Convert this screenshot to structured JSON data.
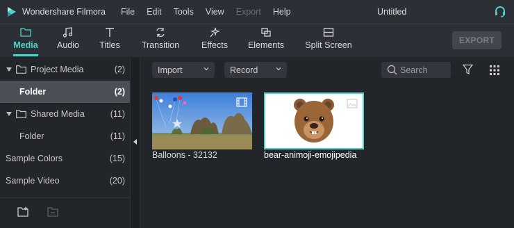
{
  "app": {
    "name": "Wondershare Filmora",
    "document_title": "Untitled"
  },
  "menu": [
    {
      "label": "File",
      "enabled": true
    },
    {
      "label": "Edit",
      "enabled": true
    },
    {
      "label": "Tools",
      "enabled": true
    },
    {
      "label": "View",
      "enabled": true
    },
    {
      "label": "Export",
      "enabled": false
    },
    {
      "label": "Help",
      "enabled": true
    }
  ],
  "toolbar": {
    "tabs": [
      {
        "label": "Media",
        "icon": "folder-icon",
        "active": true
      },
      {
        "label": "Audio",
        "icon": "music-note-icon",
        "active": false
      },
      {
        "label": "Titles",
        "icon": "text-icon",
        "active": false
      },
      {
        "label": "Transition",
        "icon": "transition-icon",
        "active": false
      },
      {
        "label": "Effects",
        "icon": "effects-icon",
        "active": false
      },
      {
        "label": "Elements",
        "icon": "elements-icon",
        "active": false
      },
      {
        "label": "Split Screen",
        "icon": "split-screen-icon",
        "active": false
      }
    ],
    "export_label": "EXPORT"
  },
  "sidebar": {
    "items": [
      {
        "label": "Project Media",
        "count": "(2)"
      },
      {
        "label": "Folder",
        "count": "(2)"
      },
      {
        "label": "Shared Media",
        "count": "(11)"
      },
      {
        "label": "Folder",
        "count": "(11)"
      },
      {
        "label": "Sample Colors",
        "count": "(15)"
      },
      {
        "label": "Sample Video",
        "count": "(20)"
      }
    ]
  },
  "media": {
    "import_label": "Import",
    "record_label": "Record",
    "search_placeholder": "Search",
    "items": [
      {
        "caption": "Balloons - 32132",
        "type": "video"
      },
      {
        "caption": "bear-animoji-emojipedia",
        "type": "image"
      }
    ]
  },
  "colors": {
    "accent": "#4fd1c8",
    "panel": "#2c3036",
    "background": "#22262b",
    "selected": "#4a4e55"
  }
}
